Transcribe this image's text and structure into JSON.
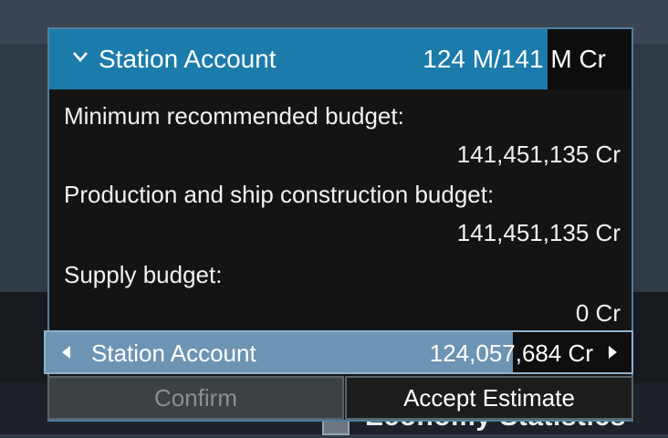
{
  "account_panel": {
    "title": "Station Account",
    "amount": "124 M/141 M Cr",
    "rows": [
      {
        "label": "Minimum recommended budget:",
        "value": "141,451,135 Cr"
      },
      {
        "label": "Production and ship construction budget:",
        "value": "141,451,135 Cr"
      },
      {
        "label": "Supply budget:",
        "value": "0 Cr"
      }
    ]
  },
  "selector": {
    "label": "Station Account",
    "value": "124,057,684 Cr"
  },
  "buttons": {
    "confirm": "Confirm",
    "accept": "Accept Estimate"
  },
  "background": {
    "section_title": "Economy Statistics"
  },
  "colors": {
    "header_blue": "#1b7bab",
    "selector_blue": "#6e94b4",
    "panel_bg": "#141414"
  }
}
